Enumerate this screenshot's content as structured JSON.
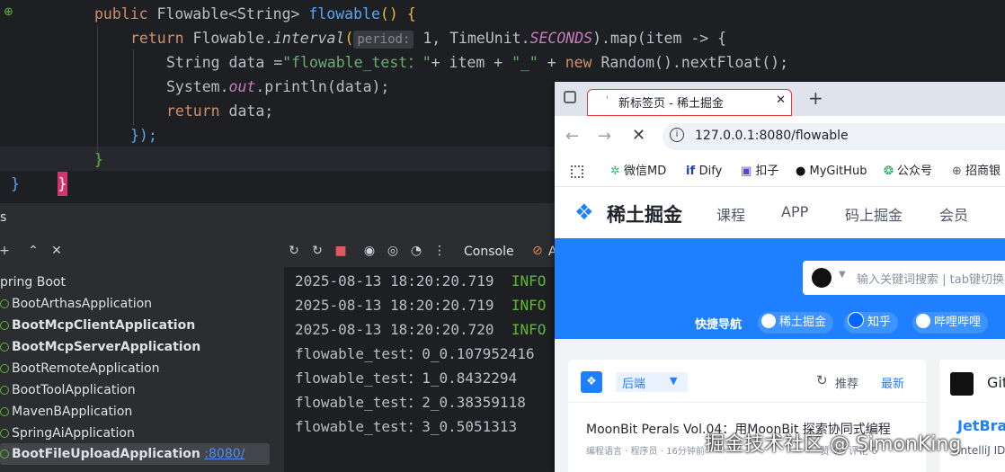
{
  "editor": {
    "line1": {
      "kw": "public ",
      "type": "Flowable<String> ",
      "fn": "flowable",
      "rest": "() {"
    },
    "line2": {
      "kw": "return ",
      "a": "Flowable.",
      "fn": "interval",
      "b": "(",
      "hint": "period:",
      "c": " 1, TimeUnit.",
      "const": "SECONDS",
      "d": ").map(item -> {"
    },
    "line3": {
      "a": "String data =",
      "str": "\"flowable_test：\"",
      "b": "+ item + ",
      "str2": "\"_\"",
      "c": " + ",
      "kw": "new ",
      "d": "Random().nextFloat();"
    },
    "line4": {
      "a": "System.",
      "const": "out",
      "b": ".println(data);"
    },
    "line5": {
      "kw": "return ",
      "a": "data;"
    },
    "line6": "});",
    "line7": "}",
    "line8": "}",
    "line9": "}"
  },
  "run_panel": {
    "title": "s",
    "tree_root": "pring Boot",
    "apps": [
      {
        "name": "BootArthasApplication",
        "bold": false
      },
      {
        "name": "BootMcpClientApplication",
        "bold": true
      },
      {
        "name": "BootMcpServerApplication",
        "bold": true
      },
      {
        "name": "BootRemoteApplication",
        "bold": false
      },
      {
        "name": "BootToolApplication",
        "bold": false
      },
      {
        "name": "MavenBApplication",
        "bold": false
      },
      {
        "name": "SpringAiApplication",
        "bold": false
      }
    ],
    "selected_app": "BootFileUploadApplication",
    "selected_port": ":8080/",
    "console_tab": "Console",
    "console_tab2": "A",
    "log_lines": [
      {
        "ts": "2025-08-13 18:20:20.719",
        "level": "INFO"
      },
      {
        "ts": "2025-08-13 18:20:20.719",
        "level": "INFO"
      },
      {
        "ts": "2025-08-13 18:20:20.720",
        "level": "INFO"
      }
    ],
    "output_lines": [
      "flowable_test：0_0.107952416",
      "flowable_test：1_0.8432294",
      "flowable_test：2_0.38359118",
      "flowable_test：3_0.5051313"
    ]
  },
  "browser": {
    "tab_title": "新标签页 - 稀土掘金",
    "close_glyph": "✕",
    "new_tab_glyph": "+",
    "url": "127.0.0.1:8080/flowable",
    "bookmarks": [
      "微信MD",
      "Dify",
      "扣子",
      "MyGitHub",
      "公众号",
      "招商银"
    ],
    "site": {
      "logo_text": "稀土掘金",
      "nav": [
        "课程",
        "APP",
        "码上掘金",
        "会员"
      ],
      "search_placeholder": "输入关键词搜索 | tab键切换",
      "quick_nav_label": "快捷导航",
      "quick_nav": [
        "稀土掘金",
        "知乎",
        "哔哩哔哩"
      ],
      "feed_source": "后端",
      "sort_recommend": "推荐",
      "sort_latest": "最新",
      "article_title": "MoonBit Perals Vol.04：用MoonBit 探索协同式编程",
      "article_meta": [
        "编程语言",
        "程序员",
        "16分钟前"
      ],
      "article_stats": "赞 0 · 评论 0",
      "side_card_title": "Git",
      "side_card_link": "JetBra",
      "side_card_sub": "IntelliJ ID"
    }
  },
  "watermark": "掘金技术社区 @ SimonKing",
  "colors": {
    "editor_bg": "#1e1f22",
    "panel_bg": "#2b2d30",
    "keyword": "#cf8e6d",
    "function": "#56a8f5",
    "string": "#6aab73",
    "juejin_blue": "#1e80ff",
    "tab_highlight": "#e03a3a"
  }
}
